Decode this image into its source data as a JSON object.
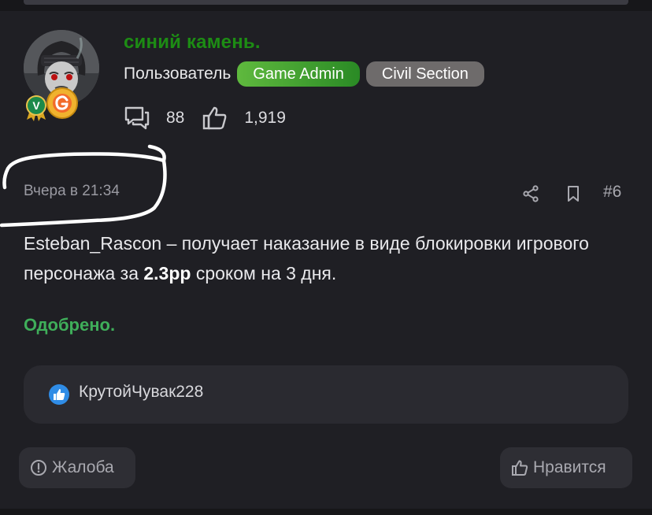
{
  "user": {
    "name": "синий камень.",
    "role": "Пользователь",
    "groups": [
      "Game Admin",
      "Civil Section"
    ],
    "messages_count": "88",
    "reactions_count": "1,919",
    "name_color": "#1d8c14"
  },
  "post": {
    "timestamp": "Вчера в 21:34",
    "number": "#6",
    "text_before": "Esteban_Rascon – получает наказание в виде блокировки игрового персонажа за ",
    "text_bold": "2.3рр",
    "text_after": " сроком на 3 дня.",
    "status": "Одобрено.",
    "status_color": "#3fae5a"
  },
  "reactions": {
    "user": "КрутойЧувак228"
  },
  "actions": {
    "report_label": "Жалоба",
    "like_label": "Нравится"
  },
  "icons": {
    "messages": "messages-icon",
    "likes": "thumbs-up-icon",
    "share": "share-icon",
    "bookmark": "bookmark-icon",
    "report": "alert-circle-icon",
    "like": "thumbs-up-icon"
  }
}
